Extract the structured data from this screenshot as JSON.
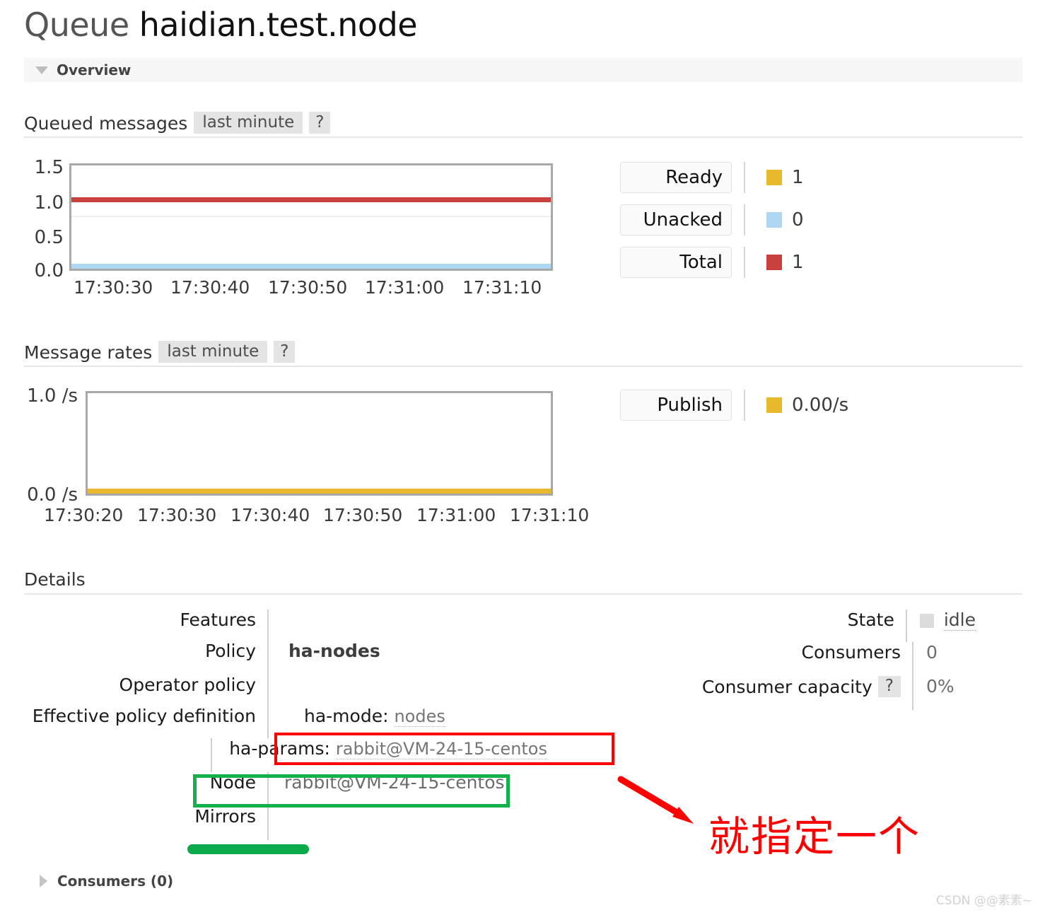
{
  "header": {
    "kind": "Queue",
    "queue_name": "haidian.test.node"
  },
  "overview_section": {
    "label": "Overview",
    "toggle_icon": "triangle-down-icon"
  },
  "queued_messages": {
    "title": "Queued messages",
    "period_chip": "last minute",
    "help_chip": "?",
    "legend": [
      {
        "label": "Ready",
        "color": "#e8b92d",
        "value": "1"
      },
      {
        "label": "Unacked",
        "color": "#aed7f4",
        "value": "0"
      },
      {
        "label": "Total",
        "color": "#c9413f",
        "value": "1"
      }
    ]
  },
  "message_rates": {
    "title": "Message rates",
    "period_chip": "last minute",
    "help_chip": "?",
    "legend": [
      {
        "label": "Publish",
        "color": "#e8b92d",
        "value": "0.00/s"
      }
    ]
  },
  "details": {
    "title": "Details",
    "left_rows": [
      {
        "key": "Features",
        "value": ""
      },
      {
        "key": "Policy",
        "value": "ha-nodes",
        "bold": true
      },
      {
        "key": "Operator policy",
        "value": ""
      },
      {
        "key": "Effective policy definition",
        "value": ""
      }
    ],
    "policy_definition": [
      {
        "name": "ha-mode:",
        "value": "nodes"
      },
      {
        "name": "ha-params:",
        "value": "rabbit@VM-24-15-centos"
      }
    ],
    "node_row": {
      "key": "Node",
      "value": "rabbit@VM-24-15-centos"
    },
    "mirrors_row": {
      "key": "Mirrors",
      "value": ""
    },
    "right_rows": [
      {
        "key": "State",
        "value": "idle",
        "swatch": "#dcdcdc"
      },
      {
        "key": "Consumers",
        "value": "0"
      },
      {
        "key": "Consumer capacity",
        "value": "0%",
        "help_chip": "?"
      }
    ]
  },
  "consumers_section": {
    "label": "Consumers (0)",
    "toggle_icon": "triangle-right-icon"
  },
  "annotations": {
    "chinese_note": "就指定一个",
    "red_color": "#ff0000",
    "green_color": "#0aa94a",
    "arrow_icon": "arrow-down-right-icon"
  },
  "watermark": "CSDN @@素素~",
  "chart_data": [
    {
      "type": "line",
      "title": "Queued messages",
      "subtitle": "last minute",
      "xlabel": "",
      "ylabel": "",
      "ylim": [
        0,
        1.5
      ],
      "yticks": [
        "1.5",
        "1.0",
        "0.5",
        "0.0"
      ],
      "xticks": [
        "17:30:30",
        "17:30:40",
        "17:30:50",
        "17:31:00",
        "17:31:10"
      ],
      "grid": true,
      "legend_position": "right",
      "series": [
        {
          "name": "Total",
          "color": "#c9413f",
          "constant_value": 1,
          "values": [
            1,
            1,
            1,
            1,
            1
          ]
        },
        {
          "name": "Ready",
          "color": "#e8b92d",
          "constant_value": 1,
          "values": [
            1,
            1,
            1,
            1,
            1
          ]
        },
        {
          "name": "Unacked",
          "color": "#aed7f4",
          "constant_value": 0,
          "values": [
            0,
            0,
            0,
            0,
            0
          ]
        }
      ]
    },
    {
      "type": "line",
      "title": "Message rates",
      "subtitle": "last minute",
      "xlabel": "",
      "ylabel": "",
      "ylim": [
        0,
        1.0
      ],
      "yticks": [
        "1.0 /s",
        "0.0 /s"
      ],
      "xticks": [
        "17:30:20",
        "17:30:30",
        "17:30:40",
        "17:30:50",
        "17:31:00",
        "17:31:10"
      ],
      "grid": false,
      "legend_position": "right",
      "series": [
        {
          "name": "Publish",
          "color": "#e8b92d",
          "constant_value": 0,
          "values": [
            0,
            0,
            0,
            0,
            0,
            0
          ]
        }
      ]
    }
  ]
}
